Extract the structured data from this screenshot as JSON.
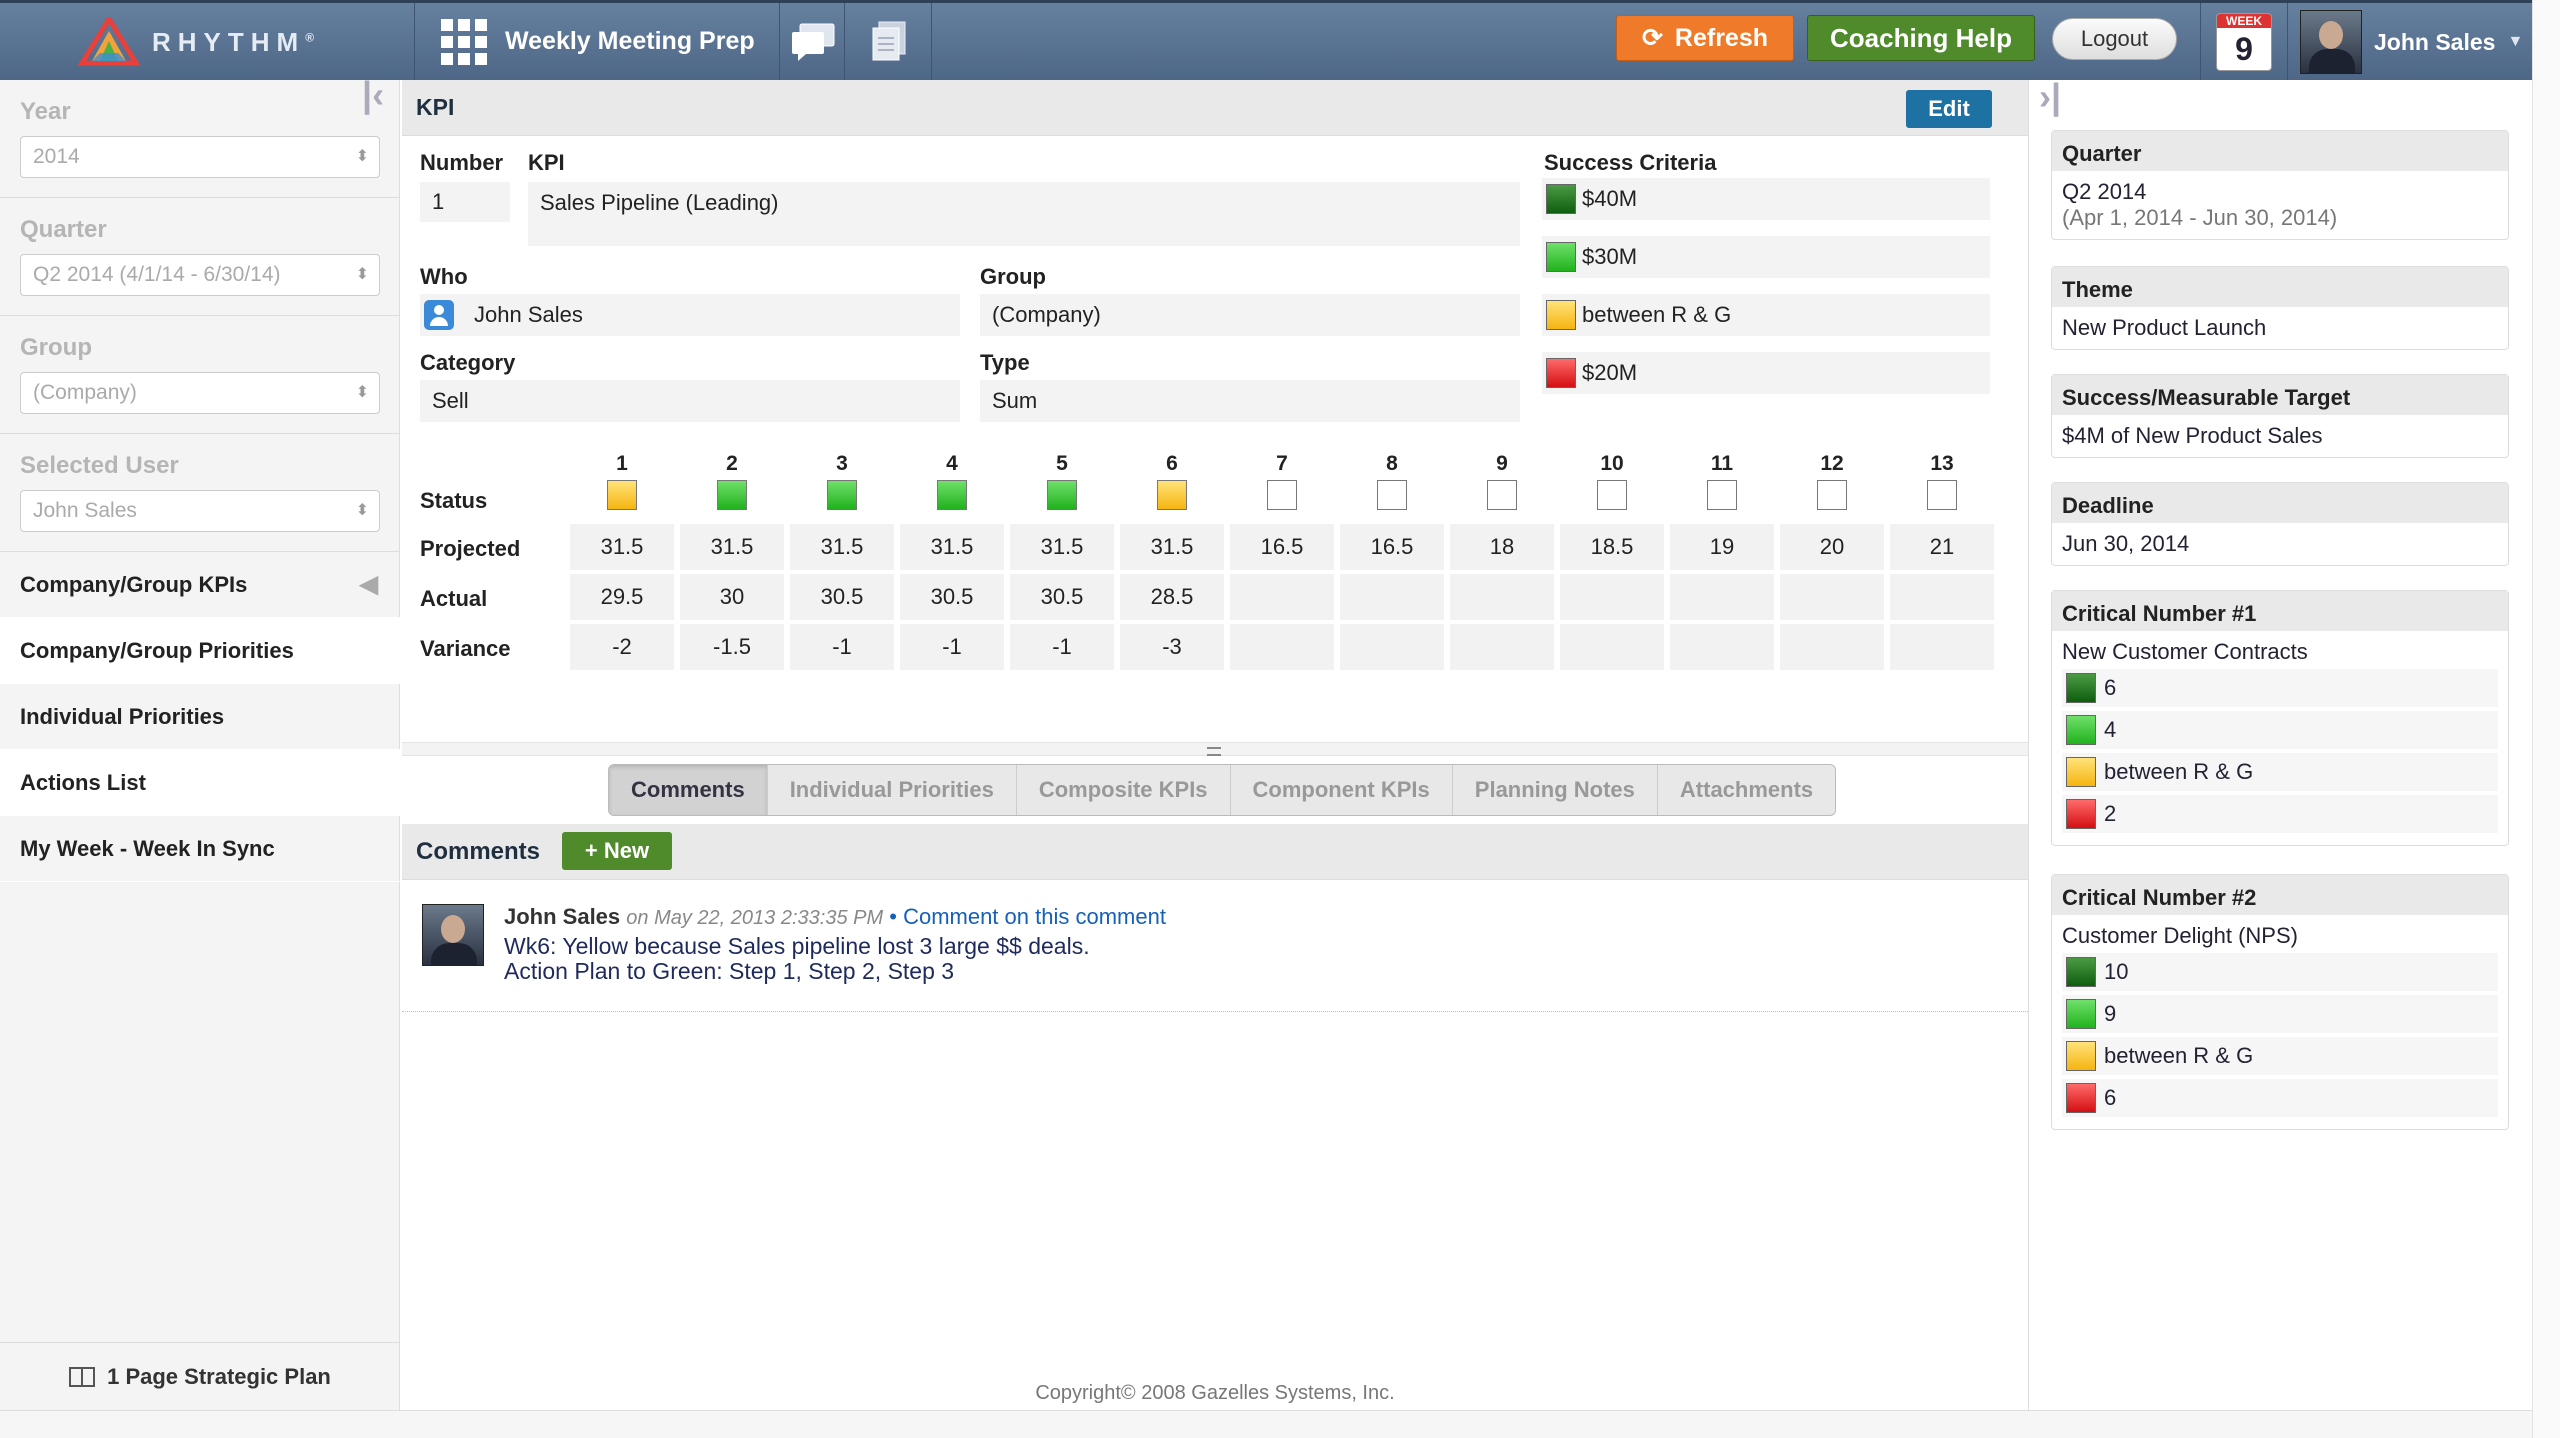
{
  "header": {
    "brand": "RHYTHM",
    "brand_mark": "®",
    "page_title": "Weekly Meeting Prep",
    "refresh_label": "Refresh",
    "coaching_label": "Coaching Help",
    "logout_label": "Logout",
    "week_label": "WEEK",
    "week_number": "9",
    "user_name": "John Sales",
    "colors": {
      "refresh": "#ef7a2a",
      "coaching": "#4f8a2b",
      "bar": "#5a7393"
    }
  },
  "sidebar": {
    "year": {
      "label": "Year",
      "value": "2014"
    },
    "quarter": {
      "label": "Quarter",
      "value": "Q2 2014 (4/1/14 - 6/30/14)"
    },
    "group": {
      "label": "Group",
      "value": "(Company)"
    },
    "selected_user": {
      "label": "Selected User",
      "value": "John Sales"
    },
    "items": [
      {
        "label": "Company/Group KPIs"
      },
      {
        "label": "Company/Group Priorities"
      },
      {
        "label": "Individual Priorities"
      },
      {
        "label": "Actions List"
      },
      {
        "label": "My Week - Week In Sync"
      }
    ],
    "strategic_plan": "1 Page Strategic Plan"
  },
  "kpi": {
    "section_title": "KPI",
    "edit_label": "Edit",
    "number_label": "Number",
    "number_value": "1",
    "kpi_label": "KPI",
    "kpi_value": "Sales Pipeline (Leading)",
    "who_label": "Who",
    "who_value": "John Sales",
    "group_label": "Group",
    "group_value": "(Company)",
    "category_label": "Category",
    "category_value": "Sell",
    "type_label": "Type",
    "type_value": "Sum",
    "success_label": "Success Criteria",
    "success": [
      {
        "color": "dark-green",
        "text": "$40M"
      },
      {
        "color": "green",
        "text": "$30M"
      },
      {
        "color": "yellow",
        "text": "between R & G"
      },
      {
        "color": "red",
        "text": "$20M"
      }
    ],
    "status_label": "Status",
    "projected_label": "Projected",
    "actual_label": "Actual",
    "variance_label": "Variance",
    "weeks": [
      "1",
      "2",
      "3",
      "4",
      "5",
      "6",
      "7",
      "8",
      "9",
      "10",
      "11",
      "12",
      "13"
    ],
    "status": [
      "yellow",
      "green",
      "green",
      "green",
      "green",
      "yellow",
      "empty",
      "empty",
      "empty",
      "empty",
      "empty",
      "empty",
      "empty"
    ],
    "projected": [
      "31.5",
      "31.5",
      "31.5",
      "31.5",
      "31.5",
      "31.5",
      "16.5",
      "16.5",
      "18",
      "18.5",
      "19",
      "20",
      "21"
    ],
    "actual": [
      "29.5",
      "30",
      "30.5",
      "30.5",
      "30.5",
      "28.5",
      "",
      "",
      "",
      "",
      "",
      "",
      ""
    ],
    "variance": [
      "-2",
      "-1.5",
      "-1",
      "-1",
      "-1",
      "-3",
      "",
      "",
      "",
      "",
      "",
      "",
      ""
    ]
  },
  "tabs": [
    "Comments",
    "Individual Priorities",
    "Composite KPIs",
    "Component KPIs",
    "Planning Notes",
    "Attachments"
  ],
  "comments": {
    "title": "Comments",
    "new_label": "+ New",
    "entries": [
      {
        "author": "John Sales",
        "date": "on May 22, 2013 2:33:35 PM",
        "reply_link": "• Comment on this comment",
        "line1": "Wk6: Yellow because Sales pipeline lost 3 large $$ deals.",
        "line2": "Action Plan to Green: Step 1, Step 2, Step 3"
      }
    ]
  },
  "copyright": "Copyright© 2008 Gazelles Systems, Inc.",
  "right_panel": {
    "quarter": {
      "title": "Quarter",
      "value": "Q2 2014",
      "range": "(Apr 1, 2014 - Jun 30, 2014)"
    },
    "theme": {
      "title": "Theme",
      "value": "New Product Launch"
    },
    "target": {
      "title": "Success/Measurable Target",
      "value": "$4M of New Product Sales"
    },
    "deadline": {
      "title": "Deadline",
      "value": "Jun 30, 2014"
    },
    "critical1": {
      "title": "Critical Number #1",
      "name": "New Customer Contracts",
      "rows": [
        {
          "color": "dark-green",
          "text": "6"
        },
        {
          "color": "green",
          "text": "4"
        },
        {
          "color": "yellow",
          "text": "between R & G"
        },
        {
          "color": "red",
          "text": "2"
        }
      ]
    },
    "critical2": {
      "title": "Critical Number #2",
      "name": "Customer Delight (NPS)",
      "rows": [
        {
          "color": "dark-green",
          "text": "10"
        },
        {
          "color": "green",
          "text": "9"
        },
        {
          "color": "yellow",
          "text": "between R & G"
        },
        {
          "color": "red",
          "text": "6"
        }
      ]
    }
  }
}
